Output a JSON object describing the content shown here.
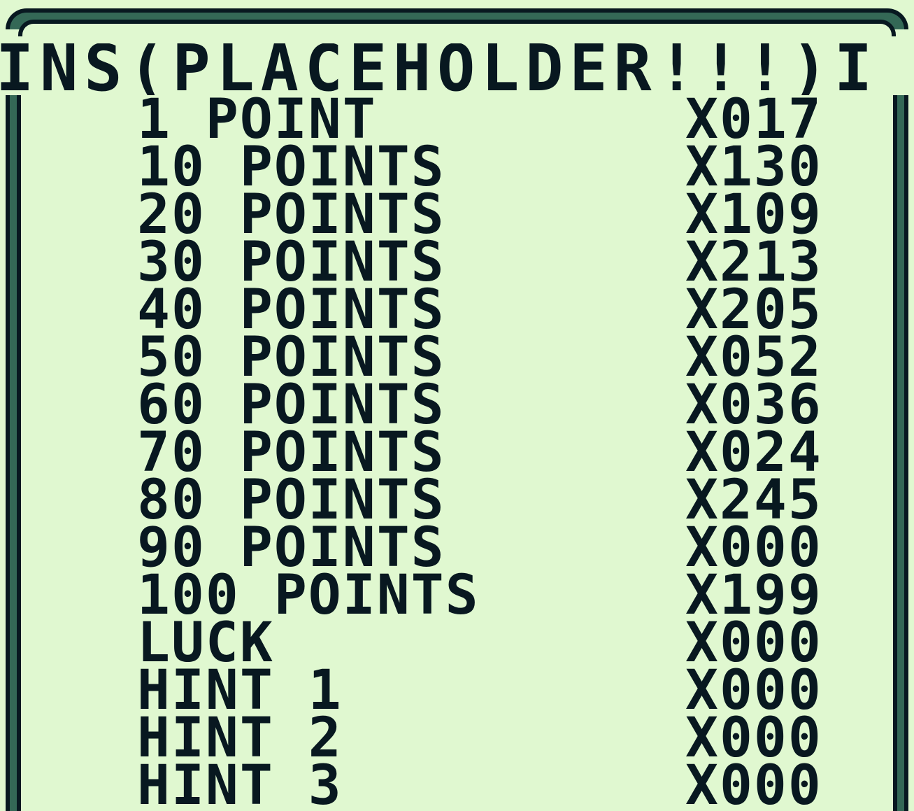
{
  "screen": {
    "title": "INS(PLACEHOLDER!!!)I",
    "colors": {
      "background": "#e0f8d0",
      "ink": "#081820",
      "frame_mid": "#346856"
    }
  },
  "items": [
    {
      "label": "1 POINT",
      "count": "X017"
    },
    {
      "label": "10 POINTS",
      "count": "X130"
    },
    {
      "label": "20 POINTS",
      "count": "X109"
    },
    {
      "label": "30 POINTS",
      "count": "X213"
    },
    {
      "label": "40 POINTS",
      "count": "X205"
    },
    {
      "label": "50 POINTS",
      "count": "X052"
    },
    {
      "label": "60 POINTS",
      "count": "X036"
    },
    {
      "label": "70 POINTS",
      "count": "X024"
    },
    {
      "label": "80 POINTS",
      "count": "X245"
    },
    {
      "label": "90 POINTS",
      "count": "X000"
    },
    {
      "label": "100 POINTS",
      "count": "X199"
    },
    {
      "label": "LUCK",
      "count": "X000"
    },
    {
      "label": "HINT 1",
      "count": "X000"
    },
    {
      "label": "HINT 2",
      "count": "X000"
    },
    {
      "label": "HINT 3",
      "count": "X000"
    }
  ]
}
